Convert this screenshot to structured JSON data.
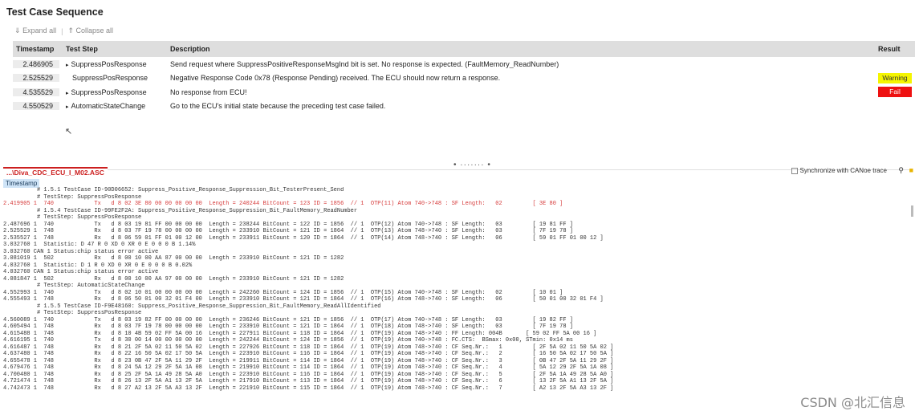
{
  "title": "Test Case Sequence",
  "toolbar": {
    "expand_all": "Expand all",
    "collapse_all": "Collapse all",
    "expand_icon": "chevron-double-down",
    "collapse_icon": "chevron-double-up"
  },
  "table": {
    "headers": {
      "timestamp": "Timestamp",
      "step": "Test Step",
      "description": "Description",
      "result": "Result"
    },
    "rows": [
      {
        "timestamp": "2.486905",
        "step": "SuppressPosResponse",
        "bullet": true,
        "description": "Send request where SuppressPositiveResponseMsgInd bit is set. No response is expected. (FaultMemory_ReadNumber)",
        "result": ""
      },
      {
        "timestamp": "2.525529",
        "step": "SuppressPosResponse",
        "bullet": false,
        "description": "Negative Response Code 0x78 (Response Pending) received. The ECU should now return a response.",
        "result": "Warning"
      },
      {
        "timestamp": "4.535529",
        "step": "SuppressPosResponse",
        "bullet": true,
        "description": "No response from ECU!",
        "result": "Fail"
      },
      {
        "timestamp": "4.550529",
        "step": "AutomaticStateChange",
        "bullet": true,
        "description": "Go to the ECU's initial state because the preceding test case failed.",
        "result": ""
      }
    ]
  },
  "colors": {
    "warning": "#f5f500",
    "fail": "#ee1111",
    "accent_red": "#cc1f1f"
  },
  "splitter": "• ······· •",
  "trace_tab": "...\\Diva_CDC_ECU_I_M02.ASC",
  "sync_label": "Synchronize with CANoe trace",
  "search_icon": "magnifier",
  "folder_icon": "folder",
  "ts_column": "Timestamp",
  "trace_lines": [
    {
      "t": "          # 1.5.1 TestCase ID-90D06652: Suppress_Positive_Response_Suppression_Bit_TesterPresent_Send",
      "red": false
    },
    {
      "t": "          # TestStep: SuppressPosResponse",
      "red": false
    },
    {
      "t": "2.419905 1  740            Tx   d 8 02 3E 80 00 00 00 00 00  Length = 240244 BitCount = 123 ID = 1856  // 1  OTP(11) Atom 740->748 : SF Length:   02         [ 3E 80 ]",
      "red": true
    },
    {
      "t": "          # 1.5.4 TestCase ID-99FE2F2A: Suppress_Positive_Response_Suppression_Bit_FaultMemory_ReadNumber",
      "red": false
    },
    {
      "t": "          # TestStep: SuppressPosResponse",
      "red": false
    },
    {
      "t": "2.487696 1  740            Tx   d 8 03 19 81 FF 00 00 00 00  Length = 238244 BitCount = 122 ID = 1856  // 1  OTP(12) Atom 740->748 : SF Length:   03         [ 19 81 FF ]",
      "red": false
    },
    {
      "t": "2.525529 1  748            Rx   d 8 03 7F 19 78 00 00 00 00  Length = 233910 BitCount = 121 ID = 1864  // 1  OTP(13) Atom 748->740 : SF Length:   03         [ 7F 19 78 ]",
      "red": false
    },
    {
      "t": "2.535527 1  748            Rx   d 8 06 59 01 FF 01 00 12 00  Length = 233911 BitCount = 120 ID = 1864  // 1  OTP(14) Atom 748->740 : SF Length:   06         [ 59 01 FF 01 00 12 ]",
      "red": false
    },
    {
      "t": "3.032760 1  Statistic: D 47 R 0 XD 0 XR 0 E 0 0 0 B 1.14%",
      "red": false
    },
    {
      "t": "3.032760 CAN 1 Status:chip status error active",
      "red": false
    },
    {
      "t": "3.081019 1  502            Rx   d 8 00 10 00 AA 87 00 00 00  Length = 233910 BitCount = 121 ID = 1282",
      "red": false
    },
    {
      "t": "4.032760 1  Statistic: D 1 R 0 XD 0 XR 0 E 0 0 0 B 0.02%",
      "red": false
    },
    {
      "t": "4.032760 CAN 1 Status:chip status error active",
      "red": false
    },
    {
      "t": "4.081847 1  502            Rx   d 8 00 10 00 AA 97 00 00 00  Length = 233910 BitCount = 121 ID = 1282",
      "red": false
    },
    {
      "t": "          # TestStep: AutomaticStateChange",
      "red": false
    },
    {
      "t": "4.552993 1  740            Tx   d 8 02 10 01 00 00 00 00 00  Length = 242260 BitCount = 124 ID = 1856  // 1  OTP(15) Atom 740->748 : SF Length:   02         [ 10 01 ]",
      "red": false
    },
    {
      "t": "4.555493 1  748            Rx   d 8 06 50 01 00 32 01 F4 00  Length = 233910 BitCount = 121 ID = 1864  // 1  OTP(16) Atom 748->740 : SF Length:   06         [ 50 01 00 32 01 F4 ]",
      "red": false
    },
    {
      "t": "          # 1.5.5 TestCase ID-F9E48160: Suppress_Positive_Response_Suppression_Bit_FaultMemory_ReadAllIdentified",
      "red": false
    },
    {
      "t": "          # TestStep: SuppressPosResponse",
      "red": false
    },
    {
      "t": "4.560089 1  740            Tx   d 8 03 19 82 FF 00 00 00 00  Length = 236246 BitCount = 121 ID = 1856  // 1  OTP(17) Atom 740->748 : SF Length:   03         [ 19 82 FF ]",
      "red": false
    },
    {
      "t": "4.605494 1  748            Rx   d 8 03 7F 19 78 00 00 00 00  Length = 233910 BitCount = 121 ID = 1864  // 1  OTP(18) Atom 748->740 : SF Length:   03         [ 7F 19 78 ]",
      "red": false
    },
    {
      "t": "4.615488 1  748            Rx   d 8 10 4B 59 02 FF 5A 00 16  Length = 227911 BitCount = 118 ID = 1864  // 1  OTP(19) Atom 748->740 : FF Length: 004B       [ 59 02 FF 5A 00 16 ]",
      "red": false
    },
    {
      "t": "4.616195 1  740            Tx   d 8 30 00 14 00 00 00 00 00  Length = 242244 BitCount = 124 ID = 1856  // 1  OTP(19) Atom 740->748 : FC.CTS:  BSmax: 0x00, STmin: 0x14 ms",
      "red": false
    },
    {
      "t": "4.616487 1  748            Rx   d 8 21 2F 5A 02 11 50 5A 02  Length = 227926 BitCount = 118 ID = 1864  // 1  OTP(19) Atom 748->740 : CF Seq.Nr.:   1         [ 2F 5A 02 11 50 5A 02 ]",
      "red": false
    },
    {
      "t": "4.637480 1  748            Rx   d 8 22 16 50 5A 02 17 50 5A  Length = 223910 BitCount = 116 ID = 1864  // 1  OTP(19) Atom 748->740 : CF Seq.Nr.:   2         [ 16 50 5A 02 17 50 5A ]",
      "red": false
    },
    {
      "t": "4.655478 1  748            Rx   d 8 23 0B 47 2F 5A 11 29 2F  Length = 219911 BitCount = 114 ID = 1864  // 1  OTP(19) Atom 748->740 : CF Seq.Nr.:   3         [ 0B 47 2F 5A 11 29 2F ]",
      "red": false
    },
    {
      "t": "4.679476 1  748            Rx   d 8 24 5A 12 29 2F 5A 1A 08  Length = 219910 BitCount = 114 ID = 1864  // 1  OTP(19) Atom 748->740 : CF Seq.Nr.:   4         [ 5A 12 29 2F 5A 1A 08 ]",
      "red": false
    },
    {
      "t": "4.700480 1  748            Rx   d 8 25 2F 5A 1A 49 28 5A A0  Length = 223910 BitCount = 116 ID = 1864  // 1  OTP(19) Atom 748->740 : CF Seq.Nr.:   5         [ 2F 5A 1A 49 28 5A A0 ]",
      "red": false
    },
    {
      "t": "4.721474 1  748            Rx   d 8 26 13 2F 5A A1 13 2F 5A  Length = 217910 BitCount = 113 ID = 1864  // 1  OTP(19) Atom 748->740 : CF Seq.Nr.:   6         [ 13 2F 5A A1 13 2F 5A ]",
      "red": false
    },
    {
      "t": "4.742473 1  748            Rx   d 8 27 A2 13 2F 5A A3 13 2F  Length = 221910 BitCount = 115 ID = 1864  // 1  OTP(19) Atom 748->740 : CF Seq.Nr.:   7         [ A2 13 2F 5A A3 13 2F ]",
      "red": false
    }
  ],
  "watermark": "CSDN @北汇信息"
}
